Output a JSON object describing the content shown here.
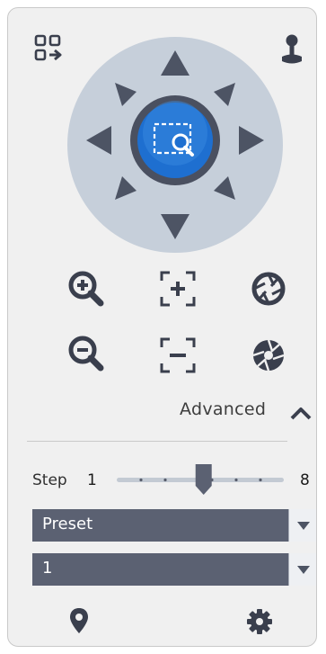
{
  "advanced": {
    "label": "Advanced"
  },
  "step": {
    "label": "Step",
    "value": "1",
    "max": "8",
    "level": 0.52
  },
  "preset_select": {
    "value": "Preset"
  },
  "preset_number_select": {
    "value": "1"
  },
  "icons": [
    "grid-swap-icon",
    "joystick-icon",
    "direction-up-icon",
    "direction-up-right-icon",
    "direction-right-icon",
    "direction-down-right-icon",
    "direction-down-icon",
    "direction-down-left-icon",
    "direction-left-icon",
    "direction-up-left-icon",
    "area-zoom-icon",
    "zoom-in-icon",
    "focus-near-icon",
    "iris-open-icon",
    "zoom-out-icon",
    "focus-far-icon",
    "iris-close-icon",
    "chevron-up-icon",
    "location-pin-icon",
    "settings-gear-icon"
  ],
  "colors": {
    "panel_bg": "#f0f0f0",
    "ptz_ring": "#c6cfda",
    "ptz_arrows": "#4d5464",
    "center_button": "#1e6fd0",
    "select_bg": "#5b6172"
  }
}
